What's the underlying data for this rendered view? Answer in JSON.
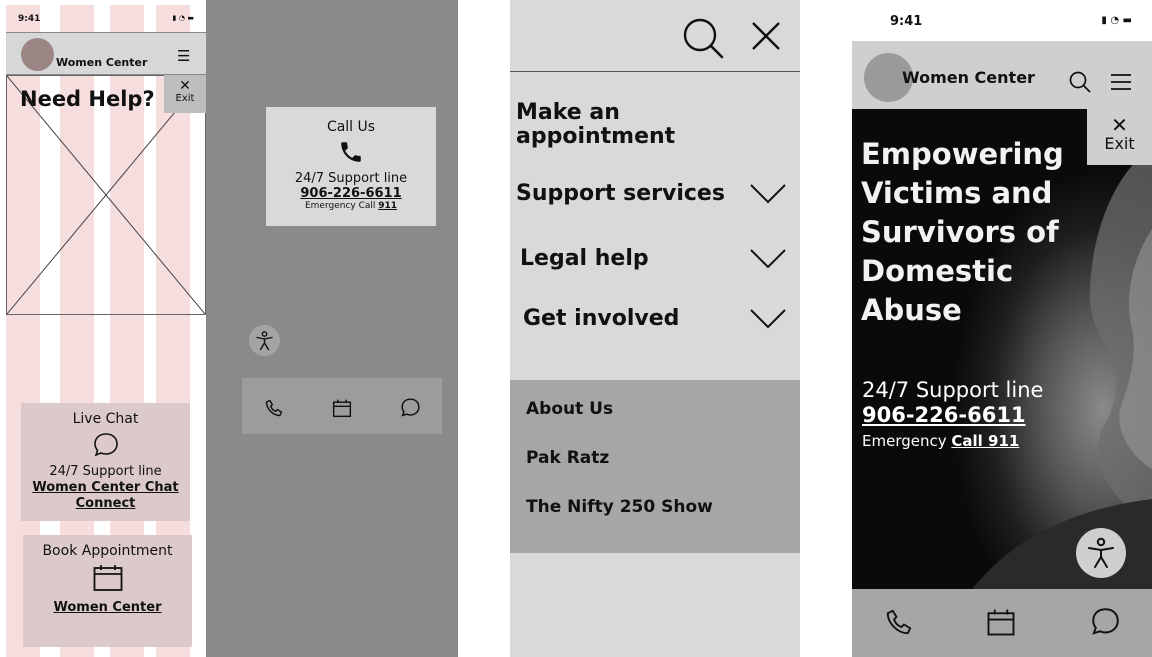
{
  "frame1": {
    "status_time": "9:41",
    "brand": "Women Center",
    "hero_title": "Need Help?",
    "exit_label": "Exit",
    "live_chat": {
      "title": "Live Chat",
      "line1": "24/7 Support line",
      "link": "Women Center Chat Connect"
    },
    "book": {
      "title": "Book Appointment",
      "link": "Women Center"
    }
  },
  "frame2": {
    "call_title": "Call Us",
    "support_line": "24/7 Support line",
    "phone": "906-226-6611",
    "emergency_prefix": "Emergency Call ",
    "emergency_number": "911"
  },
  "frame3": {
    "menu": [
      {
        "label": "Make an appointment"
      },
      {
        "label": "Support services"
      },
      {
        "label": "Legal help"
      },
      {
        "label": "Get involved"
      }
    ],
    "secondary": [
      "About Us",
      "Pak Ratz",
      "The Nifty 250 Show"
    ]
  },
  "frame4": {
    "status_time": "9:41",
    "brand": "Women Center",
    "exit_label": "Exit",
    "headline": "Empowering Victims and Survivors of Domestic Abuse",
    "support_line": "24/7 Support line",
    "phone": "906-226-6611",
    "emergency_prefix": "Emergency ",
    "emergency_link": "Call 911"
  }
}
